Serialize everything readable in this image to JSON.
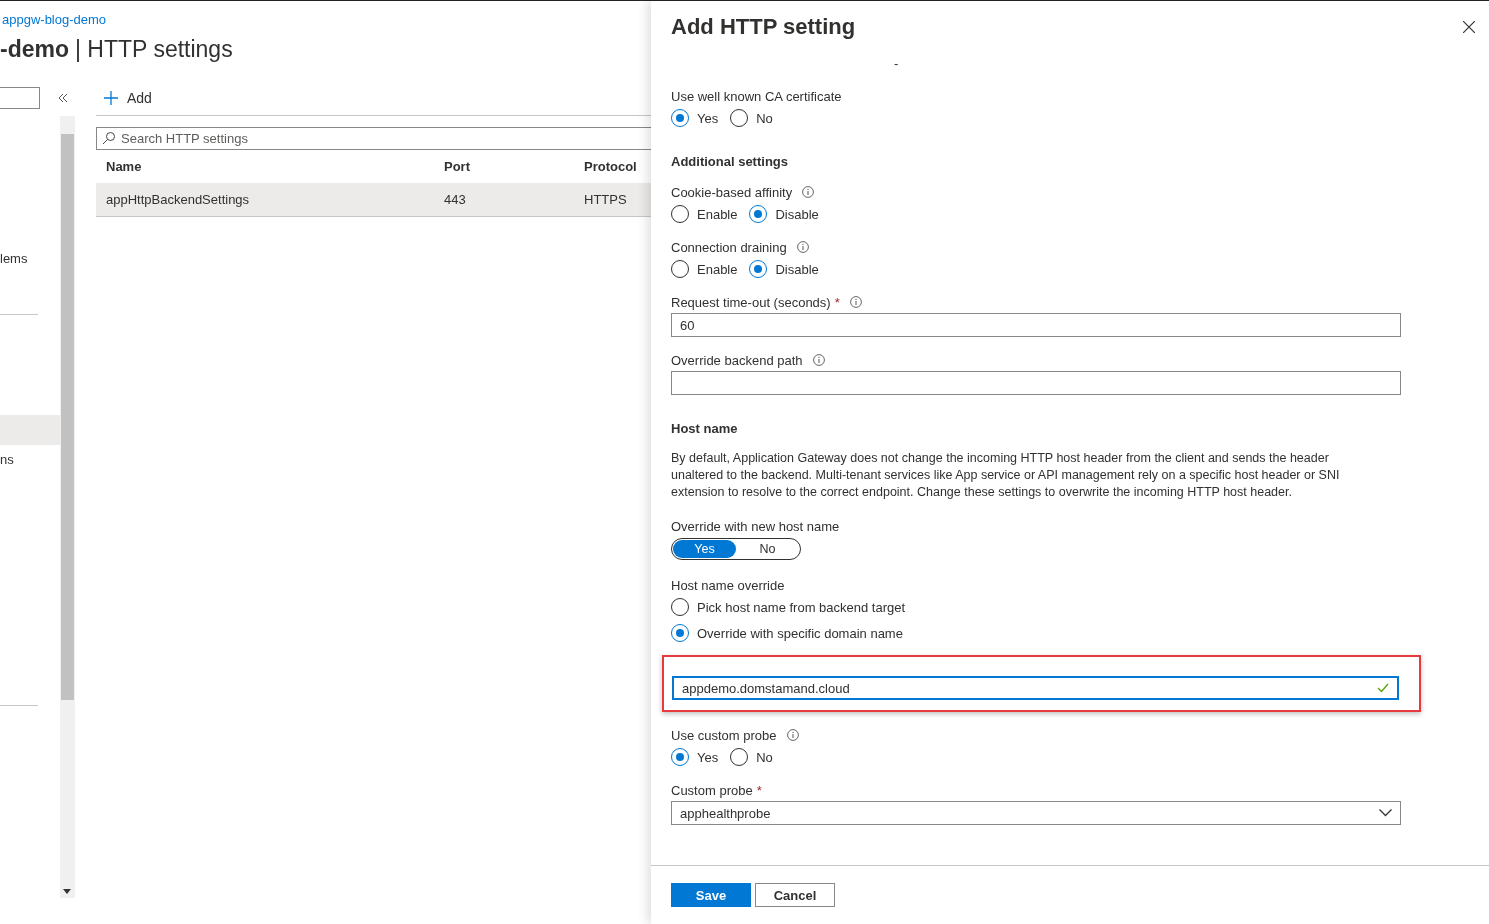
{
  "page": {
    "breadcrumb": "appgw-blog-demo",
    "title_bold": "-demo",
    "title_rest": "| HTTP settings"
  },
  "nav": {
    "items": [
      {
        "label": "lems",
        "selected": false
      },
      {
        "selected": true
      },
      {
        "label": "ns",
        "selected": false
      }
    ]
  },
  "toolbar": {
    "add": "Add"
  },
  "search": {
    "placeholder": "Search HTTP settings"
  },
  "table": {
    "columns": [
      "Name",
      "Port",
      "Protocol"
    ],
    "rows": [
      {
        "selected": true,
        "cells": [
          "appHttpBackendSettings",
          "443",
          "HTTPS"
        ]
      }
    ]
  },
  "panel": {
    "title": "Add HTTP setting",
    "fields": [
      {
        "kind": "note",
        "text": "-"
      },
      {
        "kind": "radio",
        "label": "Use well known CA certificate",
        "info": false,
        "options": [
          {
            "label": "Yes",
            "selected": true
          },
          {
            "label": "No",
            "selected": false
          }
        ]
      },
      {
        "kind": "heading",
        "text": "Additional settings"
      },
      {
        "kind": "radio",
        "label": "Cookie-based affinity",
        "info": true,
        "options": [
          {
            "label": "Enable",
            "selected": false
          },
          {
            "label": "Disable",
            "selected": true
          }
        ]
      },
      {
        "kind": "radio",
        "label": "Connection draining",
        "info": true,
        "options": [
          {
            "label": "Enable",
            "selected": false
          },
          {
            "label": "Disable",
            "selected": true
          }
        ]
      },
      {
        "kind": "text",
        "label": "Request time-out (seconds)",
        "required_mark": "*",
        "info": true,
        "value": "60"
      },
      {
        "kind": "text",
        "label": "Override backend path",
        "info": true
      },
      {
        "kind": "heading",
        "text": "Host name"
      },
      {
        "kind": "paragraph",
        "text": "By default, Application Gateway does not change the incoming HTTP host header from the client and sends the header unaltered to the backend. Multi-tenant services like App service or API management rely on a specific host header or SNI extension to resolve to the correct endpoint. Change these settings to overwrite the incoming HTTP host header."
      },
      {
        "kind": "toggle",
        "label": "Override with new host name",
        "options": [
          {
            "label": "Yes",
            "selected": true
          },
          {
            "label": "No",
            "selected": false
          }
        ]
      },
      {
        "kind": "radio-list",
        "label": "Host name override",
        "options": [
          {
            "label": "Pick host name from backend target",
            "selected": false
          },
          {
            "label": "Override with specific domain name",
            "selected": true
          }
        ]
      },
      {
        "kind": "text",
        "highlighted": true,
        "valid": true,
        "value": "appdemo.domstamand.cloud"
      },
      {
        "kind": "radio",
        "label": "Use custom probe",
        "info": true,
        "options": [
          {
            "label": "Yes",
            "selected": true
          },
          {
            "label": "No",
            "selected": false
          }
        ]
      },
      {
        "kind": "select",
        "label": "Custom probe",
        "required_mark": "*",
        "info": false,
        "value": "apphealthprobe"
      }
    ],
    "buttons": [
      {
        "label": "Save",
        "primary": true
      },
      {
        "label": "Cancel",
        "primary": false
      }
    ]
  }
}
